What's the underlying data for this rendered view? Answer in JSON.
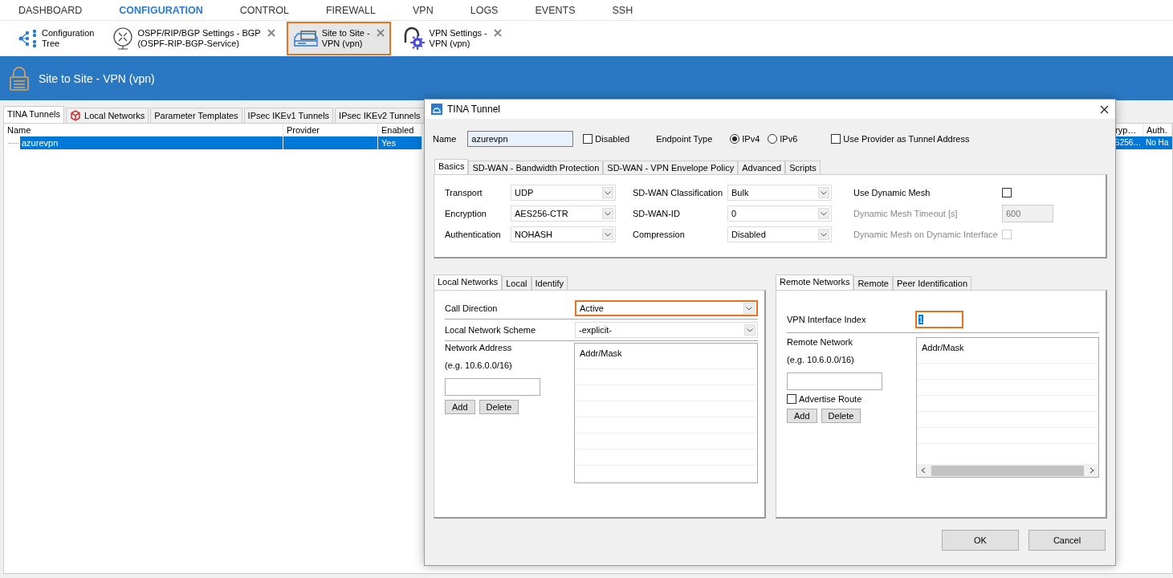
{
  "nav": [
    {
      "label": "DASHBOARD",
      "selected": false
    },
    {
      "label": "CONFIGURATION",
      "selected": true
    },
    {
      "label": "CONTROL",
      "selected": false
    },
    {
      "label": "FIREWALL",
      "selected": false
    },
    {
      "label": "VPN",
      "selected": false
    },
    {
      "label": "LOGS",
      "selected": false
    },
    {
      "label": "EVENTS",
      "selected": false
    },
    {
      "label": "SSH",
      "selected": false
    }
  ],
  "open_tabs": [
    {
      "kind": "tree",
      "lines": [
        "Configuration",
        "Tree"
      ],
      "closable": false,
      "selected": false
    },
    {
      "kind": "router",
      "lines": [
        "OSPF/RIP/BGP Settings - BGP",
        "(OSPF-RIP-BGP-Service)"
      ],
      "closable": true,
      "selected": false
    },
    {
      "kind": "sites",
      "lines": [
        "Site to Site -",
        "VPN (vpn)"
      ],
      "closable": true,
      "selected": true
    },
    {
      "kind": "settings",
      "lines": [
        "VPN Settings -",
        "VPN (vpn)"
      ],
      "closable": true,
      "selected": false
    }
  ],
  "header": {
    "title": "Site to Site - VPN (vpn)"
  },
  "tabs": [
    {
      "label": "TINA Tunnels",
      "selected": true,
      "kind": "plain"
    },
    {
      "label": "Local Networks",
      "selected": false,
      "kind": "cube"
    },
    {
      "label": "Parameter Templates",
      "selected": false,
      "kind": "plain"
    },
    {
      "label": "IPsec IKEv1 Tunnels",
      "selected": false,
      "kind": "plain"
    },
    {
      "label": "IPsec IKEv2 Tunnels",
      "selected": false,
      "kind": "plain"
    }
  ],
  "table": {
    "columns": [
      "Name",
      "Provider",
      "Enabled",
      "ryp…",
      "Auth."
    ],
    "rows": [
      {
        "name": "azurevpn",
        "enabled": "Yes",
        "column_4": "S256…",
        "column_5": "No Ha",
        "selected": true
      }
    ]
  },
  "dialog": {
    "title": "TINA Tunnel",
    "name": {
      "label": "Name",
      "value": "azurevpn"
    },
    "disabled": {
      "label": "Disabled",
      "checked": false
    },
    "endpoint_type": {
      "label": "Endpoint Type",
      "options": [
        {
          "label": "IPv4",
          "selected": true
        },
        {
          "label": "IPv6",
          "selected": false
        }
      ]
    },
    "provider_address": {
      "label": "Use Provider as Tunnel Address",
      "checked": false
    },
    "tabs": [
      {
        "label": "Basics",
        "selected": true
      },
      {
        "label": "SD-WAN - Bandwidth Protection",
        "selected": false
      },
      {
        "label": "SD-WAN - VPN Envelope Policy",
        "selected": false
      },
      {
        "label": "Advanced",
        "selected": false
      },
      {
        "label": "Scripts",
        "selected": false
      }
    ],
    "basics": {
      "column_1": [
        {
          "label": "Transport",
          "value": "UDP"
        },
        {
          "label": "Encryption",
          "value": "AES256-CTR"
        },
        {
          "label": "Authentication",
          "value": "NOHASH"
        }
      ],
      "column_2": [
        {
          "label": "SD-WAN Classification",
          "value": "Bulk"
        },
        {
          "label": "SD-WAN-ID",
          "value": "0"
        },
        {
          "label": "Compression",
          "value": "Disabled"
        }
      ],
      "column_3": [
        {
          "kind": "checkbox",
          "label": "Use Dynamic Mesh",
          "checked": false,
          "disabled": false
        },
        {
          "kind": "input",
          "label": "Dynamic Mesh Timeout [s]",
          "value": "600",
          "disabled": true
        },
        {
          "kind": "checkbox",
          "label": "Dynamic Mesh on Dynamic Interface",
          "checked": false,
          "disabled": true
        }
      ]
    },
    "local": {
      "tabs": [
        {
          "label": "Local Networks",
          "selected": true
        },
        {
          "label": "Local",
          "selected": false
        },
        {
          "label": "Identify",
          "selected": false
        }
      ],
      "call_direction": {
        "label": "Call Direction",
        "value": "Active",
        "focused": true
      },
      "scheme": {
        "label": "Local Network Scheme",
        "value": "-explicit-",
        "focused": false
      },
      "network_label": "Network Address",
      "hint": "(e.g. 10.6.0.0/16)",
      "buttons": [
        "Add",
        "Delete"
      ],
      "list_header": "Addr/Mask"
    },
    "remote": {
      "tabs": [
        {
          "label": "Remote Networks",
          "selected": true
        },
        {
          "label": "Remote",
          "selected": false
        },
        {
          "label": "Peer Identification",
          "selected": false
        }
      ],
      "interface_index": {
        "label": "VPN Interface Index",
        "value": "1",
        "focused": true
      },
      "network_label": "Remote Network",
      "hint": "(e.g. 10.6.0.0/16)",
      "advertise": {
        "label": "Advertise Route",
        "checked": false
      },
      "buttons": [
        "Add",
        "Delete"
      ],
      "list_header": "Addr/Mask"
    },
    "buttons": [
      "OK",
      "Cancel"
    ]
  }
}
